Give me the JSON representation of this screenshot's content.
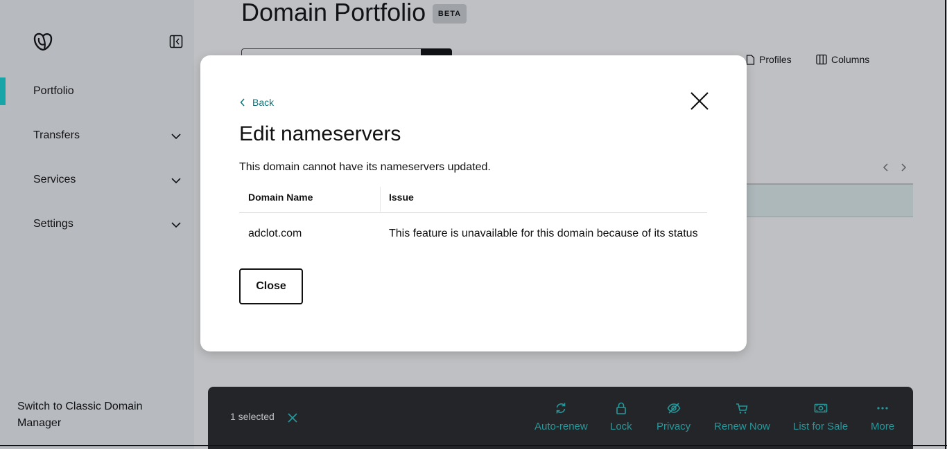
{
  "sidebar": {
    "items": [
      {
        "label": "Portfolio"
      },
      {
        "label": "Transfers"
      },
      {
        "label": "Services"
      },
      {
        "label": "Settings"
      }
    ],
    "switch_link": "Switch to Classic Domain Manager"
  },
  "header": {
    "title": "Domain Portfolio",
    "badge": "BETA"
  },
  "toolbar": {
    "profiles_label": "Profiles",
    "columns_label": "Columns"
  },
  "modal": {
    "back_label": "Back",
    "title": "Edit nameservers",
    "description": "This domain cannot have its nameservers updated.",
    "table": {
      "headers": [
        "Domain Name",
        "Issue"
      ],
      "rows": [
        [
          "adclot.com",
          "This feature is unavailable for this domain because of its status"
        ]
      ]
    },
    "close_label": "Close"
  },
  "selection_bar": {
    "count_label": "1 selected",
    "actions": [
      {
        "label": "Auto-renew",
        "icon": "refresh-icon"
      },
      {
        "label": "Lock",
        "icon": "lock-icon"
      },
      {
        "label": "Privacy",
        "icon": "eye-off-icon"
      },
      {
        "label": "Renew Now",
        "icon": "cart-icon"
      },
      {
        "label": "List for Sale",
        "icon": "money-icon"
      },
      {
        "label": "More",
        "icon": "more-icon"
      }
    ]
  },
  "colors": {
    "accent_teal": "#1bdbdb",
    "action_teal": "#2cc8c8",
    "link_teal": "#09757a",
    "selection_bar_bg": "#2b2b2b"
  }
}
